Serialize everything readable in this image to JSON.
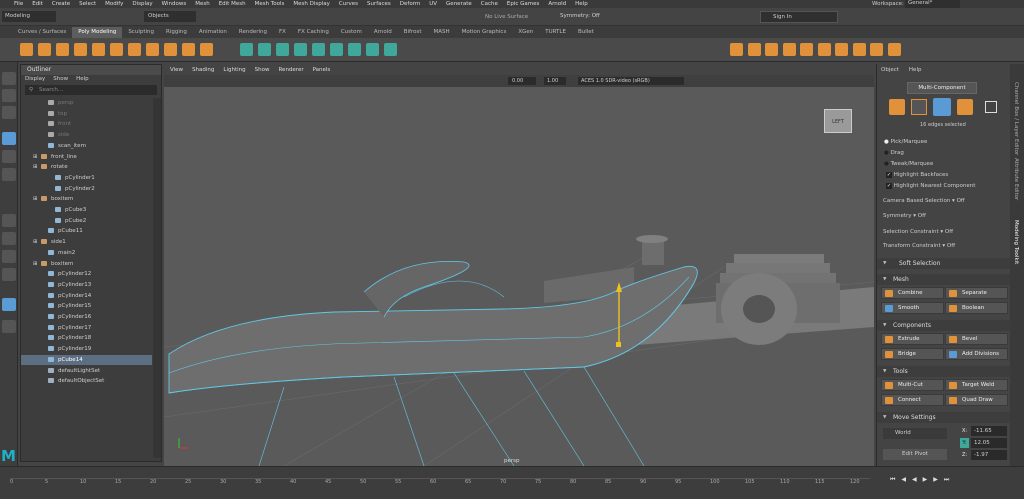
{
  "menubar": {
    "items": [
      "File",
      "Edit",
      "Create",
      "Select",
      "Modify",
      "Display",
      "Windows",
      "Mesh",
      "Edit Mesh",
      "Mesh Tools",
      "Mesh Display",
      "Curves",
      "Surfaces",
      "Deform",
      "UV",
      "Generate",
      "Cache",
      "Epic Games",
      "Arnold",
      "Help"
    ]
  },
  "status": {
    "mode": "Modeling",
    "objects": "Objects",
    "surface": "No Live Surface",
    "symmetry": "Symmetry: Off",
    "signin": "Sign In",
    "workspace_label": "Workspace:",
    "workspace_value": "General*"
  },
  "shelf": {
    "tabs": [
      "Curves / Surfaces",
      "Poly Modeling",
      "Sculpting",
      "Rigging",
      "Animation",
      "Rendering",
      "FX",
      "FX Caching",
      "Custom",
      "Arnold",
      "Bifrost",
      "MASH",
      "Motion Graphics",
      "XGen",
      "TURTLE",
      "Bullet"
    ],
    "active_index": 1
  },
  "outliner": {
    "title": "Outliner",
    "menu": [
      "Display",
      "Show",
      "Help"
    ],
    "search_placeholder": "Search...",
    "rows": [
      {
        "label": "persp",
        "indent": 1,
        "kind": "cam",
        "dim": true
      },
      {
        "label": "top",
        "indent": 1,
        "kind": "cam",
        "dim": true
      },
      {
        "label": "front",
        "indent": 1,
        "kind": "cam",
        "dim": true
      },
      {
        "label": "side",
        "indent": 1,
        "kind": "cam",
        "dim": true
      },
      {
        "label": "scan_item",
        "indent": 1,
        "kind": "mesh"
      },
      {
        "label": "front_line",
        "indent": 0,
        "kind": "group",
        "expand": "+"
      },
      {
        "label": "rotate",
        "indent": 0,
        "kind": "group",
        "expand": "-"
      },
      {
        "label": "pCylinder1",
        "indent": 2,
        "kind": "mesh"
      },
      {
        "label": "pCylinder2",
        "indent": 2,
        "kind": "mesh"
      },
      {
        "label": "boxitem",
        "indent": 0,
        "kind": "group",
        "expand": "-"
      },
      {
        "label": "pCube3",
        "indent": 2,
        "kind": "mesh"
      },
      {
        "label": "pCube2",
        "indent": 2,
        "kind": "mesh"
      },
      {
        "label": "pCube11",
        "indent": 1,
        "kind": "mesh"
      },
      {
        "label": "side1",
        "indent": 0,
        "kind": "group",
        "expand": "+"
      },
      {
        "label": "main2",
        "indent": 1,
        "kind": "mesh"
      },
      {
        "label": "boxitem",
        "indent": 0,
        "kind": "group",
        "expand": "+"
      },
      {
        "label": "pCylinder12",
        "indent": 1,
        "kind": "mesh"
      },
      {
        "label": "pCylinder13",
        "indent": 1,
        "kind": "mesh"
      },
      {
        "label": "pCylinder14",
        "indent": 1,
        "kind": "mesh"
      },
      {
        "label": "pCylinder15",
        "indent": 1,
        "kind": "mesh"
      },
      {
        "label": "pCylinder16",
        "indent": 1,
        "kind": "mesh"
      },
      {
        "label": "pCylinder17",
        "indent": 1,
        "kind": "mesh"
      },
      {
        "label": "pCylinder18",
        "indent": 1,
        "kind": "mesh"
      },
      {
        "label": "pCylinder19",
        "indent": 1,
        "kind": "mesh"
      },
      {
        "label": "pCube14",
        "indent": 1,
        "kind": "mesh",
        "selected": true
      },
      {
        "label": "defaultLightSet",
        "indent": 1,
        "kind": "set"
      },
      {
        "label": "defaultObjectSet",
        "indent": 1,
        "kind": "set"
      }
    ]
  },
  "viewport": {
    "menu": [
      "View",
      "Shading",
      "Lighting",
      "Show",
      "Renderer",
      "Panels"
    ],
    "val1": "0.00",
    "val2": "1.00",
    "colorspace": "ACES 1.0 SDR-video (sRGB)",
    "camera": "persp",
    "viewcube": "LEFT"
  },
  "attr": {
    "menu": [
      "Object",
      "Help"
    ],
    "title": "Multi-Component",
    "selected_info": "16 edges selected",
    "options": [
      "Pick/Marquee",
      "Drag",
      "Tweak/Marquee"
    ],
    "checks": [
      "Highlight Backfaces",
      "Highlight Nearest Component"
    ],
    "camera_based": "Camera Based Selection",
    "camera_based_val": "Off",
    "symmetry": "Symmetry",
    "symmetry_val": "Off",
    "sel_constraint": "Selection Constraint",
    "sel_constraint_val": "Off",
    "xf_constraint": "Transform Constraint",
    "xf_constraint_val": "Off",
    "soft": "Soft Selection",
    "mesh_head": "Mesh",
    "mesh_btns": [
      "Combine",
      "Separate",
      "Smooth",
      "Boolean"
    ],
    "comp_head": "Components",
    "comp_btns": [
      "Extrude",
      "Bevel",
      "Bridge",
      "Add Divisions"
    ],
    "tools_head": "Tools",
    "tools_btns": [
      "Multi-Cut",
      "Target Weld",
      "Connect",
      "Quad Draw"
    ],
    "move_head": "Move Settings",
    "world": "World",
    "edit_pivot": "Edit Pivot",
    "x_label": "X:",
    "x_val": "-11.65",
    "y_label": "Y:",
    "y_val": "12.05",
    "z_label": "Z:",
    "z_val": "-1.97"
  },
  "sidetabs": [
    "Channel Box / Layer Editor",
    "Attribute Editor",
    "Modeling Toolkit"
  ],
  "timeline": {
    "ticks": [
      "0",
      "5",
      "10",
      "15",
      "20",
      "25",
      "30",
      "35",
      "40",
      "45",
      "50",
      "55",
      "60",
      "65",
      "70",
      "75",
      "80",
      "85",
      "90",
      "95",
      "100",
      "105",
      "110",
      "115",
      "120"
    ]
  },
  "colors": {
    "accent": "#5b9bd5",
    "orange": "#e0913a",
    "teal": "#3fa89a",
    "cyan": "#62c8e6",
    "yellow": "#f0c020"
  }
}
